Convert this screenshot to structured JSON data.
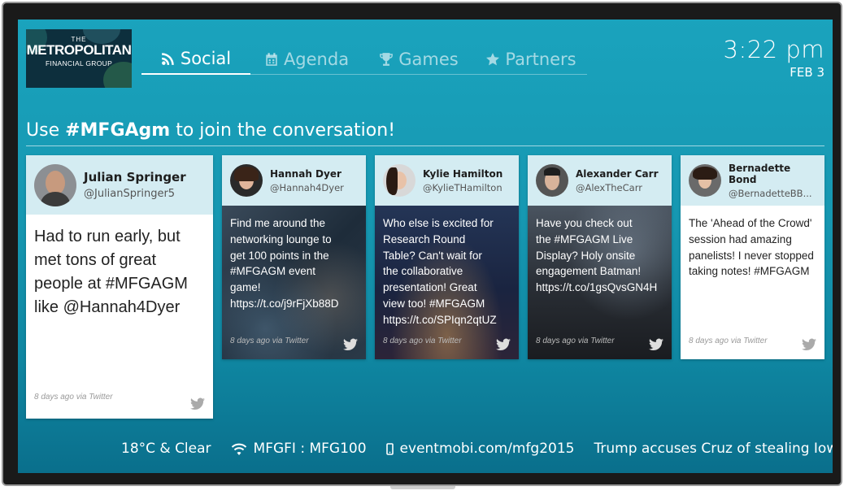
{
  "logo": {
    "line1": "THE",
    "line2": "METROPOLITAN",
    "line3": "FINANCIAL GROUP"
  },
  "nav": [
    {
      "label": "Social",
      "icon": "rss-icon",
      "active": true
    },
    {
      "label": "Agenda",
      "icon": "calendar-icon",
      "active": false
    },
    {
      "label": "Games",
      "icon": "trophy-icon",
      "active": false
    },
    {
      "label": "Partners",
      "icon": "star-icon",
      "active": false
    }
  ],
  "clock": {
    "time": "3:22 pm",
    "date": "FEB 3"
  },
  "banner": {
    "prefix": "Use ",
    "hashtag": "#MFGAgm",
    "suffix": " to join the conversation!"
  },
  "featured_post": {
    "name": "Julian Springer",
    "handle": "@JulianSpringer5",
    "text": "Had to run early, but met tons of great people at #MFGAGM like @Hannah4Dyer",
    "meta": "8 days ago via Twitter"
  },
  "posts": [
    {
      "name": "Hannah Dyer",
      "handle": "@Hannah4Dyer",
      "lines": [
        "Find me around the",
        "networking lounge to",
        "get 100 points in the",
        "#MFGAGM event",
        "game!",
        "https://t.co/j9rFjXb88D"
      ],
      "meta": "8 days ago via Twitter"
    },
    {
      "name": "Kylie Hamilton",
      "handle": "@KylieTHamilton",
      "lines": [
        "Who else is excited for",
        "Research Round",
        "Table? Can't wait for",
        "the collaborative",
        "presentation! Great",
        "view too! #MFGAGM",
        "https://t.co/SPIqn2qtUZ"
      ],
      "meta": "8 days ago via Twitter"
    },
    {
      "name": "Alexander Carr",
      "handle": "@AlexTheCarr",
      "lines": [
        "Have you check out",
        "the #MFGAGM Live",
        "Display? Holy onsite",
        "engagement Batman!",
        "https://t.co/1gsQvsGN4H"
      ],
      "meta": "8 days ago via Twitter"
    },
    {
      "name": "Bernadette Bond",
      "handle": "@BernadetteBB...",
      "text": "The 'Ahead of the Crowd' session had amazing panelists! I never stopped taking notes! #MFGAGM",
      "meta": "8 days ago via Twitter"
    }
  ],
  "ticker": {
    "weather": "18°C & Clear",
    "wifi": "MFGFI : MFG100",
    "app": "eventmobi.com/mfg2015",
    "news": "Trump accuses Cruz of stealing Iowa ca"
  },
  "colors": {
    "screen": "#1697b1",
    "card_header": "#d4ecf2"
  }
}
